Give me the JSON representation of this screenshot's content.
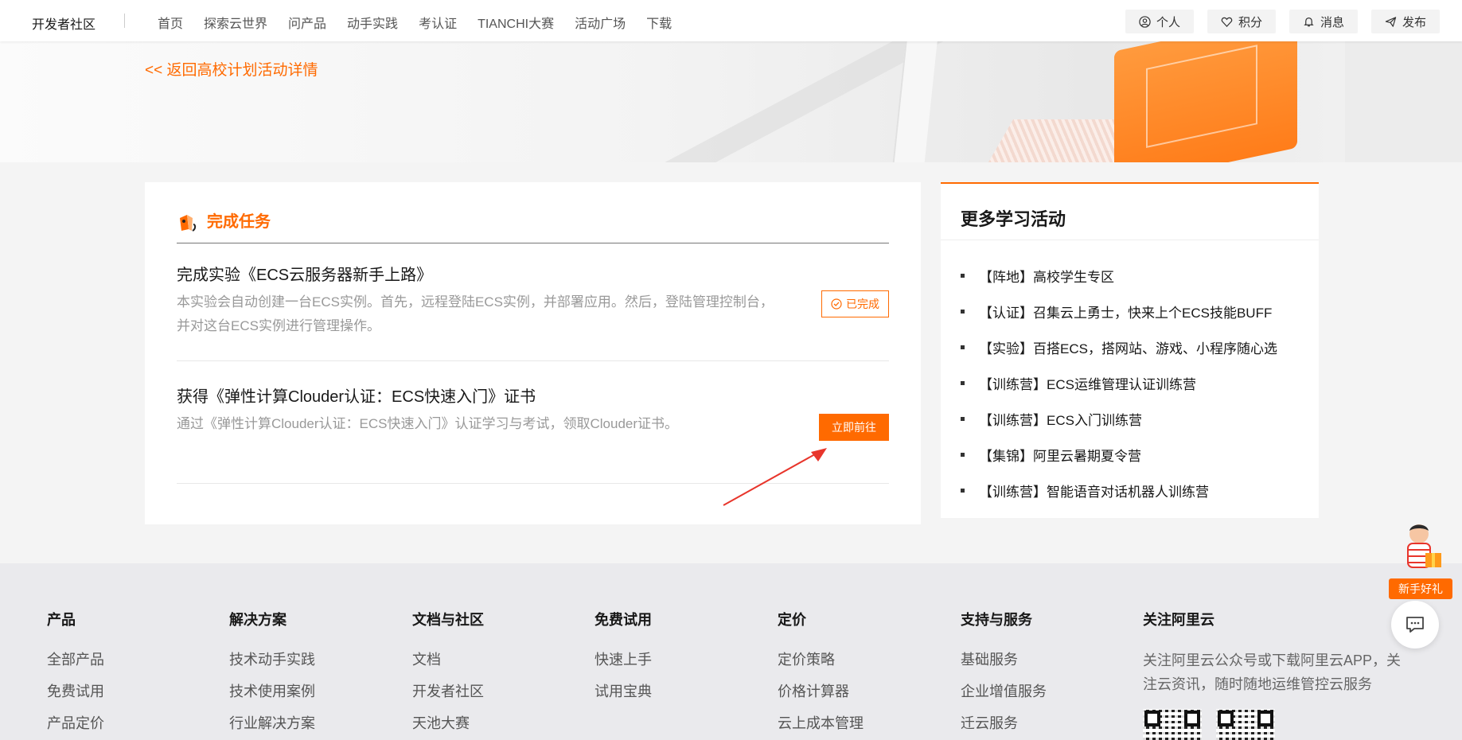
{
  "nav": {
    "brand": "开发者社区",
    "links": [
      "首页",
      "探索云世界",
      "问产品",
      "动手实践",
      "考认证",
      "TIANCHI大赛",
      "活动广场",
      "下载"
    ],
    "right": [
      {
        "label": "个人",
        "icon": "user-icon"
      },
      {
        "label": "积分",
        "icon": "heart-icon"
      },
      {
        "label": "消息",
        "icon": "bell-icon"
      },
      {
        "label": "发布",
        "icon": "send-icon"
      }
    ]
  },
  "banner": {
    "back_link": "<< 返回高校计划活动详情"
  },
  "tasks": {
    "title": "完成任务",
    "items": [
      {
        "title": "完成实验《ECS云服务器新手上路》",
        "desc": "本实验会自动创建一台ECS实例。首先，远程登陆ECS实例，并部署应用。然后，登陆管理控制台，并对这台ECS实例进行管理操作。",
        "action": "已完成"
      },
      {
        "title": "获得《弹性计算Clouder认证：ECS快速入门》证书",
        "desc": "通过《弹性计算Clouder认证：ECS快速入门》认证学习与考试，领取Clouder证书。",
        "action": "立即前往"
      }
    ]
  },
  "more": {
    "title": "更多学习活动",
    "items": [
      "【阵地】高校学生专区",
      "【认证】召集云上勇士，快来上个ECS技能BUFF",
      "【实验】百搭ECS，搭网站、游戏、小程序随心选",
      "【训练营】ECS运维管理认证训练营",
      "【训练营】ECS入门训练营",
      "【集锦】阿里云暑期夏令营",
      "【训练营】智能语音对话机器人训练营"
    ]
  },
  "footer": {
    "cols": [
      {
        "title": "产品",
        "links": [
          "全部产品",
          "免费试用",
          "产品定价"
        ]
      },
      {
        "title": "解决方案",
        "links": [
          "技术动手实践",
          "技术使用案例",
          "行业解决方案"
        ]
      },
      {
        "title": "文档与社区",
        "links": [
          "文档",
          "开发者社区",
          "天池大赛"
        ]
      },
      {
        "title": "免费试用",
        "links": [
          "快速上手",
          "试用宝典"
        ]
      },
      {
        "title": "定价",
        "links": [
          "定价策略",
          "价格计算器",
          "云上成本管理"
        ]
      },
      {
        "title": "支持与服务",
        "links": [
          "基础服务",
          "企业增值服务",
          "迁云服务"
        ]
      }
    ],
    "follow": {
      "title": "关注阿里云",
      "text": "关注阿里云公众号或下载阿里云APP，关注云资讯，随时随地运维管控云服务"
    }
  },
  "float": {
    "gift_label": "新手好礼"
  },
  "colors": {
    "accent": "#ff6a00"
  }
}
